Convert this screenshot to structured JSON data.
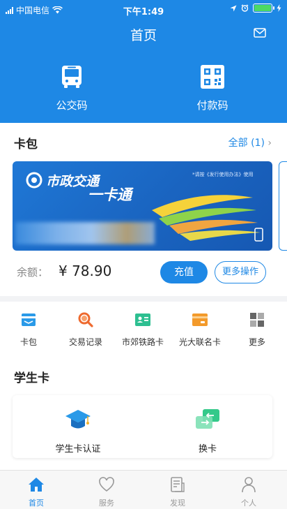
{
  "status_bar": {
    "carrier": "中国电信",
    "time": "下午1:49"
  },
  "header": {
    "title": "首页",
    "buttons": [
      {
        "label": "公交码",
        "icon": "bus-icon"
      },
      {
        "label": "付款码",
        "icon": "qr-code-icon"
      }
    ]
  },
  "wallet": {
    "title": "卡包",
    "all_label": "全部 (1)",
    "card": {
      "brand_name": "市政交通",
      "card_name": "一卡通",
      "note": "*请按《发行使用办法》使用"
    },
    "balance_label": "余额：",
    "balance_value": "¥ 78.90",
    "recharge_label": "充值",
    "more_actions_label": "更多操作"
  },
  "quick_menu": [
    {
      "label": "卡包",
      "icon": "card-wallet-icon"
    },
    {
      "label": "交易记录",
      "icon": "search-record-icon"
    },
    {
      "label": "市郊铁路卡",
      "icon": "id-card-icon"
    },
    {
      "label": "光大联名卡",
      "icon": "cobrand-card-icon"
    },
    {
      "label": "更多",
      "icon": "grid-more-icon"
    }
  ],
  "student": {
    "title": "学生卡",
    "items": [
      {
        "label": "学生卡认证",
        "icon": "graduation-cap-icon"
      },
      {
        "label": "换卡",
        "icon": "swap-card-icon"
      }
    ]
  },
  "tabs": [
    {
      "label": "首页",
      "icon": "home-icon",
      "active": true
    },
    {
      "label": "服务",
      "icon": "heart-icon",
      "active": false
    },
    {
      "label": "发现",
      "icon": "document-icon",
      "active": false
    },
    {
      "label": "个人",
      "icon": "person-icon",
      "active": false
    }
  ]
}
